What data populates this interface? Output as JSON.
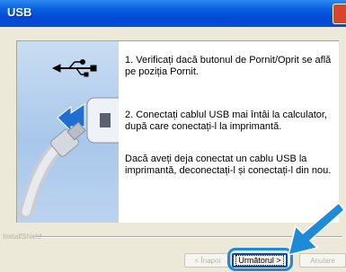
{
  "window": {
    "title": "USB"
  },
  "content": {
    "paragraph_1": "1. Verificați dacă butonul de Pornit/Oprit se află pe poziția Pornit.",
    "paragraph_2": "2. Conectați cablul USB mai întâi la calculator, după care conectați-l la imprimantă.",
    "paragraph_3": "Dacă aveți deja conectat un cablu USB la imprimantă, deconectați-l și conectați-l din nou."
  },
  "footer": {
    "brand": "InstallShield",
    "back_label": "< Înapoi",
    "next_label": "Următorul >",
    "cancel_label": "Anulare"
  },
  "colors": {
    "titlebar": "#0a5ee0",
    "highlight": "#1e8bd6"
  }
}
